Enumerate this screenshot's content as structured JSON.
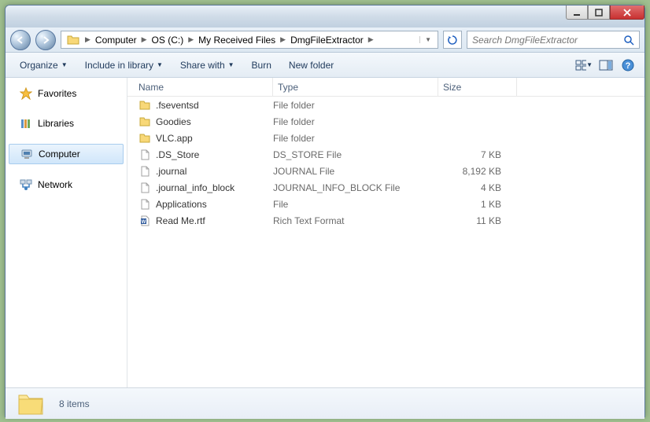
{
  "breadcrumb": [
    "Computer",
    "OS (C:)",
    "My Received Files",
    "DmgFileExtractor"
  ],
  "search": {
    "placeholder": "Search DmgFileExtractor"
  },
  "toolbar": {
    "organize": "Organize",
    "include": "Include in library",
    "share": "Share with",
    "burn": "Burn",
    "newfolder": "New folder"
  },
  "sidebar": {
    "favorites": "Favorites",
    "libraries": "Libraries",
    "computer": "Computer",
    "network": "Network"
  },
  "columns": {
    "name": "Name",
    "type": "Type",
    "size": "Size"
  },
  "files": [
    {
      "name": ".fseventsd",
      "type": "File folder",
      "size": "",
      "icon": "folder"
    },
    {
      "name": "Goodies",
      "type": "File folder",
      "size": "",
      "icon": "folder"
    },
    {
      "name": "VLC.app",
      "type": "File folder",
      "size": "",
      "icon": "folder"
    },
    {
      "name": ".DS_Store",
      "type": "DS_STORE File",
      "size": "7 KB",
      "icon": "file"
    },
    {
      "name": ".journal",
      "type": "JOURNAL File",
      "size": "8,192 KB",
      "icon": "file"
    },
    {
      "name": ".journal_info_block",
      "type": "JOURNAL_INFO_BLOCK File",
      "size": "4 KB",
      "icon": "file"
    },
    {
      "name": "Applications",
      "type": "File",
      "size": "1 KB",
      "icon": "file"
    },
    {
      "name": "Read Me.rtf",
      "type": "Rich Text Format",
      "size": "11 KB",
      "icon": "rtf"
    }
  ],
  "status": {
    "count": "8 items"
  }
}
